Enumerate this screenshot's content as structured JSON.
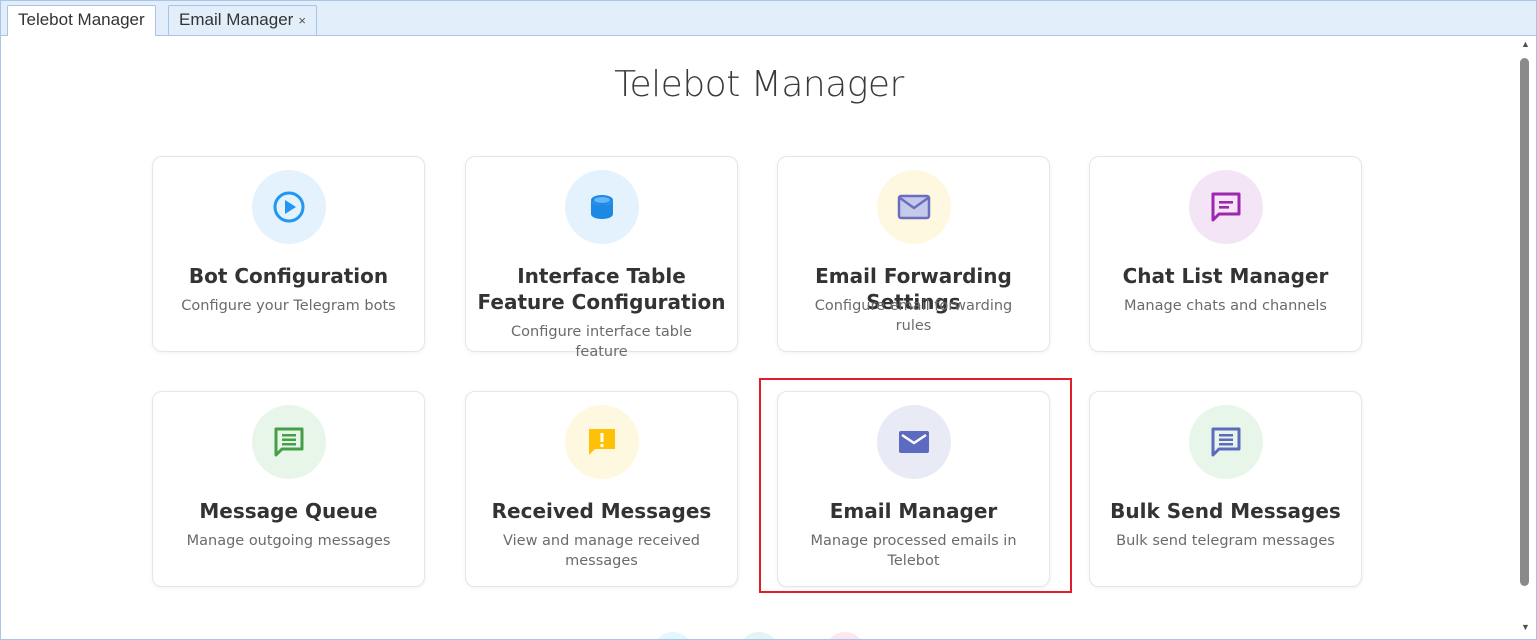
{
  "tabs": [
    {
      "label": "Telebot Manager",
      "active": true,
      "closable": false
    },
    {
      "label": "Email Manager",
      "active": false,
      "closable": true,
      "close_glyph": "×"
    }
  ],
  "page": {
    "title": "Telebot Manager"
  },
  "cards": [
    {
      "title": "Bot Configuration",
      "description": "Configure your Telegram bots",
      "icon": "play-circle-icon",
      "icon_color": "#2196f3",
      "circle_color": "#e3f2fd"
    },
    {
      "title": "Interface Table Feature Configuration",
      "description": "Configure interface table feature",
      "icon": "database-icon",
      "icon_color": "#1e88e5",
      "circle_color": "#e3f2fd"
    },
    {
      "title": "Email Forwarding Settings",
      "description": "Configure email forwarding rules",
      "icon": "envelope-outline-icon",
      "icon_color": "#6a6ec0",
      "circle_color": "#fff8e1"
    },
    {
      "title": "Chat List Manager",
      "description": "Manage chats and channels",
      "icon": "chat-icon",
      "icon_color": "#9c27b0",
      "circle_color": "#f3e5f5"
    },
    {
      "title": "Message Queue",
      "description": "Manage outgoing messages",
      "icon": "message-icon",
      "icon_color": "#43a047",
      "circle_color": "#e8f5e9"
    },
    {
      "title": "Received Messages",
      "description": "View and manage received messages",
      "icon": "alert-message-icon",
      "icon_color": "#ffc107",
      "circle_color": "#fff8e1"
    },
    {
      "title": "Email Manager",
      "description": "Manage processed emails in Telebot",
      "icon": "envelope-icon",
      "icon_color": "#5c6bc0",
      "circle_color": "#e8eaf6",
      "highlighted": true
    },
    {
      "title": "Bulk Send Messages",
      "description": "Bulk send telegram messages",
      "icon": "bulk-message-icon",
      "icon_color": "#5c6bc0",
      "circle_color": "#e8f5e9"
    }
  ],
  "colors": {
    "tab_bar": "#e3eefb",
    "border": "#a9c4e6",
    "highlight": "#e01e2b"
  }
}
